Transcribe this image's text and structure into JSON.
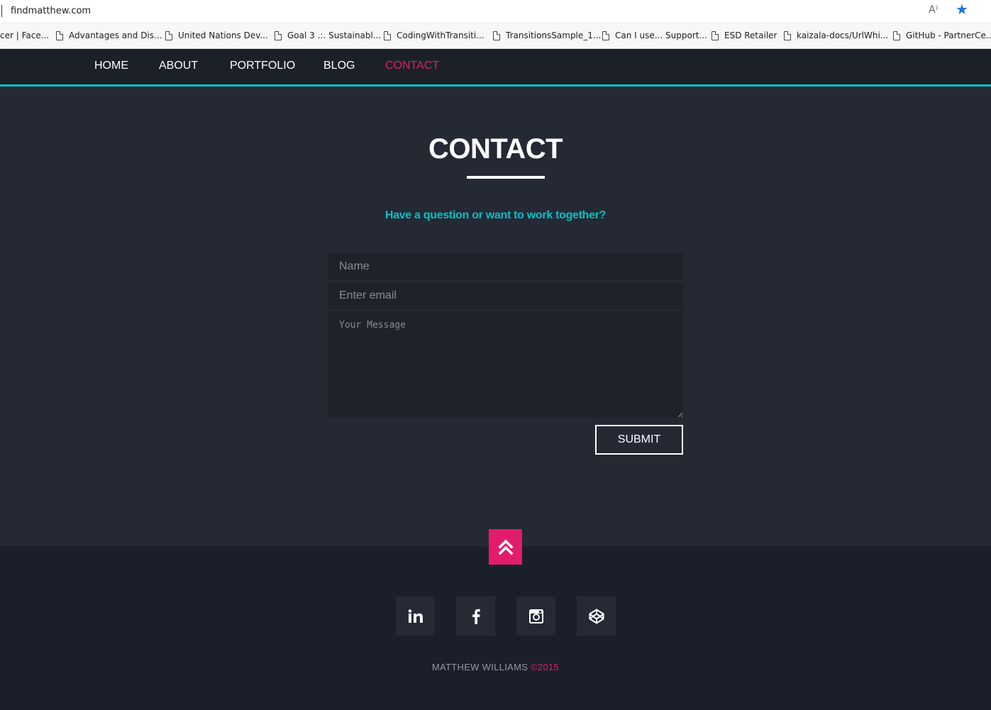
{
  "browser": {
    "url": "findmatthew.com",
    "read_aloud_label": "A⁾",
    "bookmarks": [
      "cer | Face...",
      "Advantages and Dis...",
      "United Nations Dev...",
      "Goal 3 .:. Sustainabl...",
      "CodingWithTransiti...",
      "TransitionsSample_1...",
      "Can I use... Support...",
      "ESD Retailer",
      "kaizala-docs/UrlWhi...",
      "GitHub - PartnerCe..."
    ]
  },
  "nav": {
    "items": [
      "HOME",
      "ABOUT",
      "PORTFOLIO",
      "BLOG",
      "CONTACT"
    ],
    "active": "CONTACT"
  },
  "contact": {
    "title": "CONTACT",
    "subtitle": "Have a question or want to work together?",
    "name_placeholder": "Name",
    "email_placeholder": "Enter email",
    "message_placeholder": "Your Message",
    "submit_label": "SUBMIT"
  },
  "footer": {
    "social_icons": [
      "linkedin-icon",
      "facebook-icon",
      "instagram-icon",
      "codepen-icon"
    ],
    "copyright_name": "MATTHEW WILLIAMS ",
    "copyright_year": "©2015"
  },
  "colors": {
    "accent_pink": "#e31b6d",
    "accent_teal": "#04c2c9",
    "background": "#252934",
    "nav_background": "#1c2029"
  }
}
